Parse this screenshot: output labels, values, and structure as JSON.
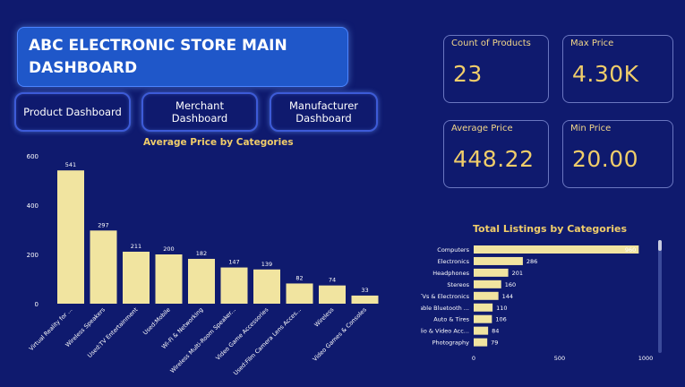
{
  "header": {
    "title": "ABC ELECTRONIC STORE MAIN DASHBOARD"
  },
  "nav": {
    "product": "Product Dashboard",
    "merchant": "Merchant Dashboard",
    "manufacturer": "Manufacturer Dashboard"
  },
  "kpis": {
    "count": {
      "label": "Count of Products",
      "value": "23"
    },
    "max": {
      "label": "Max Price",
      "value": "4.30K"
    },
    "avg": {
      "label": "Average Price",
      "value": "448.22"
    },
    "min": {
      "label": "Min Price",
      "value": "20.00"
    }
  },
  "colors": {
    "bar": "#f1e4a0",
    "accent": "#f0cd6a",
    "background": "#0f1a6e"
  },
  "chart_data": [
    {
      "type": "bar",
      "title": "Average Price by Categories",
      "categories": [
        "Virtual Reality for ...",
        "Wireless Speakers",
        "Used:TV Entertainment",
        "Used:Mobile",
        "Wi-Fi & Networking",
        "Wireless Multi-Room Speaker...",
        "Video Game Accessories",
        "Used:Film Camera Lens Acces...",
        "Wireless",
        "Video Games & Consoles"
      ],
      "values": [
        541,
        297,
        211,
        200,
        182,
        147,
        139,
        82,
        74,
        33
      ],
      "data_labels": [
        "541",
        "297",
        "211",
        "200",
        "182",
        "147",
        "139",
        "82",
        "74",
        "33"
      ],
      "ylim": [
        0,
        600
      ],
      "yticks": [
        "0",
        "200",
        "400",
        "600"
      ],
      "grid": false
    },
    {
      "type": "bar",
      "orientation": "horizontal",
      "title": "Total Listings by Categories",
      "categories": [
        "Computers",
        "Electronics",
        "Headphones",
        "Stereos",
        "TVs & Electronics",
        "Portable Bluetooth ...",
        "Auto & Tires",
        "Audio & Video Acc...",
        "Photography"
      ],
      "values": [
        960,
        286,
        201,
        160,
        144,
        110,
        106,
        84,
        79
      ],
      "data_labels": [
        "960",
        "286",
        "201",
        "160",
        "144",
        "110",
        "106",
        "84",
        "79"
      ],
      "xlim": [
        0,
        1000
      ],
      "xticks": [
        "0",
        "500",
        "1000"
      ],
      "grid": false
    }
  ]
}
